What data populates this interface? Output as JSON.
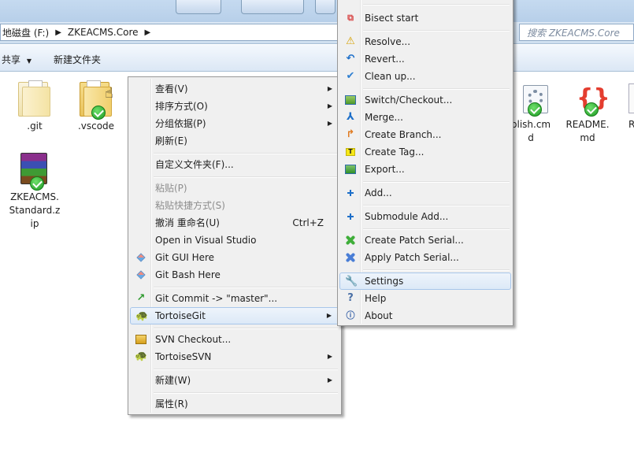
{
  "breadcrumb": {
    "drive": "地磁盘 (F:)",
    "folder": "ZKEACMS.Core"
  },
  "search": {
    "placeholder": "搜索 ZKEACMS.Core"
  },
  "toolbar": {
    "share_label": "共享",
    "new_folder_label": "新建文件夹"
  },
  "files": [
    {
      "name": ".git"
    },
    {
      "name": ".vscode"
    },
    {
      "name": "ZKEACMS.Standard.zip",
      "display": "ZKEACMS.\nStandard.z\nip"
    },
    {
      "name": "publish.cmd",
      "display": "blish.cm\nd"
    },
    {
      "name": "README.md",
      "display": "README.\nmd"
    },
    {
      "name": "R"
    }
  ],
  "context_menu": {
    "view": "查看(V)",
    "sort_by": "排序方式(O)",
    "group_by": "分组依据(P)",
    "refresh": "刷新(E)",
    "customize_folder": "自定义文件夹(F)...",
    "paste": "粘贴(P)",
    "paste_shortcut": "粘贴快捷方式(S)",
    "undo_rename": "撤消 重命名(U)",
    "undo_shortcut": "Ctrl+Z",
    "open_in_vs": "Open in Visual Studio",
    "git_gui": "Git GUI Here",
    "git_bash": "Git Bash Here",
    "git_commit": "Git Commit -> \"master\"...",
    "tortoisegit": "TortoiseGit",
    "svn_checkout": "SVN Checkout...",
    "tortoisesvn": "TortoiseSVN",
    "new": "新建(W)",
    "properties": "属性(R)"
  },
  "tortoisegit_menu": {
    "bisect_start": "Bisect start",
    "resolve": "Resolve...",
    "revert": "Revert...",
    "clean_up": "Clean up...",
    "switch_checkout": "Switch/Checkout...",
    "merge": "Merge...",
    "create_branch": "Create Branch...",
    "create_tag": "Create Tag...",
    "export": "Export...",
    "add": "Add...",
    "submodule_add": "Submodule Add...",
    "create_patch_serial": "Create Patch Serial...",
    "apply_patch_serial": "Apply Patch Serial...",
    "settings": "Settings",
    "help": "Help",
    "about": "About"
  },
  "colors": {
    "menu_bg": "#f0f0f0",
    "highlight_border": "#a8c6ea",
    "check_green": "#1f9a25",
    "git_red": "#e43d2f"
  }
}
